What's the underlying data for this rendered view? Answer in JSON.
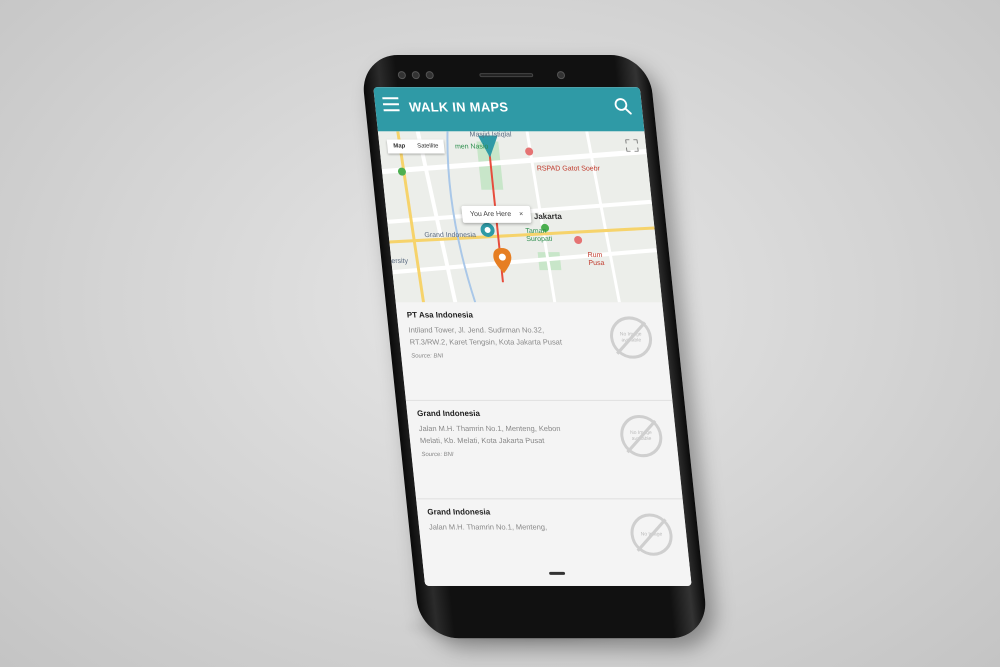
{
  "app": {
    "title": "WALK IN MAPS"
  },
  "map": {
    "tabs": [
      {
        "label": "Map",
        "active": true
      },
      {
        "label": "Satellite",
        "active": false
      }
    ],
    "bubble_text": "You Are Here",
    "bubble_close": "×",
    "labels": {
      "masjid": "Masjid Istiqlal",
      "nasional": "men Nasio",
      "rspad": "RSPAD Gatot Soebr",
      "jakarta": "Jakarta",
      "grand_indonesia": "Grand Indonesia",
      "taman": "Taman",
      "suropati": "Suropati",
      "rumah": "Rum",
      "pusat": "Pusa",
      "versity": "ersity"
    },
    "colors": {
      "route": "#e74c3c",
      "marker_blue": "#2f9aa6",
      "marker_orange": "#e67e22"
    }
  },
  "places": [
    {
      "name": "PT Asa Indonesia",
      "address": "Intiland Tower, Jl. Jend. Sudirman No.32, RT.3/RW.2, Karet Tengsin, Kota Jakarta Pusat",
      "source": "Source: BNI",
      "placeholder": "No Image available"
    },
    {
      "name": "Grand Indonesia",
      "address": "Jalan M.H. Thamrin No.1, Menteng, Kebon Melati, Kb. Melati, Kota Jakarta Pusat",
      "source": "Source: BNI",
      "placeholder": "No Image available"
    },
    {
      "name": "Grand Indonesia",
      "address": "Jalan M.H. Thamrin No.1, Menteng,",
      "source": "",
      "placeholder": "No Image"
    }
  ],
  "theme": {
    "primary": "#2f9aa6"
  }
}
